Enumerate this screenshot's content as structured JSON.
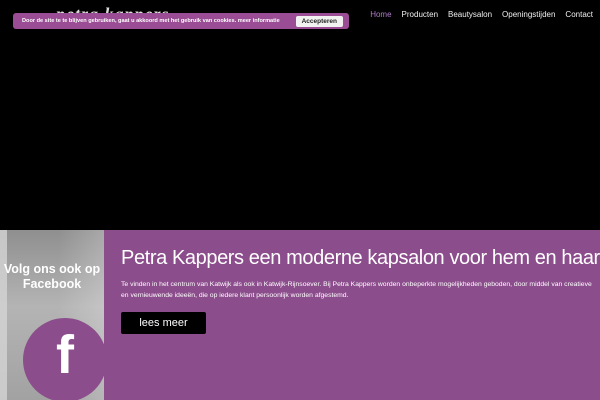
{
  "header": {
    "logo_text": "petra kappers",
    "nav": [
      {
        "label": "Home",
        "active": true
      },
      {
        "label": "Producten",
        "active": false
      },
      {
        "label": "Beautysalon",
        "active": false
      },
      {
        "label": "Openingstijden",
        "active": false
      },
      {
        "label": "Contact",
        "active": false
      }
    ]
  },
  "cookie_bar": {
    "text": "Door de site te te blijven gebruiken, gaat u akkoord met het gebruik van cookies.",
    "more_link": "meer informatie",
    "accept_label": "Accepteren"
  },
  "facebook": {
    "text": "Volg ons ook op Facebook",
    "icon_glyph": "f"
  },
  "intro": {
    "headline": "Petra Kappers een moderne kapsalon voor hem en haar",
    "description": "Te vinden in het centrum van Katwijk als ook in Katwijk-Rijnsoever. Bij Petra Kappers worden onbeperkte mogelijkheden geboden, door middel van creatieve en vernieuwende ideeën, die op iedere klant persoonlijk worden afgestemd.",
    "button_label": "lees meer"
  },
  "colors": {
    "brand_purple": "#8c4d8c",
    "cookie_bg": "#9a4d94",
    "nav_active": "#b07cc8",
    "hero_bg": "#000000"
  }
}
